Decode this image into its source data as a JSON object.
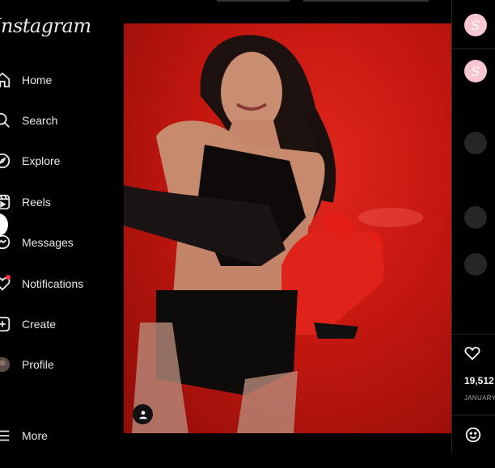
{
  "app": {
    "logo_text": "Instagram"
  },
  "sidebar": {
    "items": [
      {
        "label": "Home",
        "icon": "home-icon"
      },
      {
        "label": "Search",
        "icon": "search-icon"
      },
      {
        "label": "Explore",
        "icon": "compass-icon"
      },
      {
        "label": "Reels",
        "icon": "reels-icon"
      },
      {
        "label": "Messages",
        "icon": "messenger-icon"
      },
      {
        "label": "Notifications",
        "icon": "heart-icon"
      },
      {
        "label": "Create",
        "icon": "plus-square-icon"
      },
      {
        "label": "Profile",
        "icon": "avatar-icon"
      }
    ],
    "more_label": "More"
  },
  "post": {
    "image_alt_colors": {
      "background": "#c41710",
      "heart_box": "#e31d14"
    },
    "likes": "19,512",
    "date": "JANUARY",
    "account_monogram": "S"
  },
  "colors": {
    "accent_notification": "#ff3040",
    "avatar_pink": "#f7c6d2"
  }
}
